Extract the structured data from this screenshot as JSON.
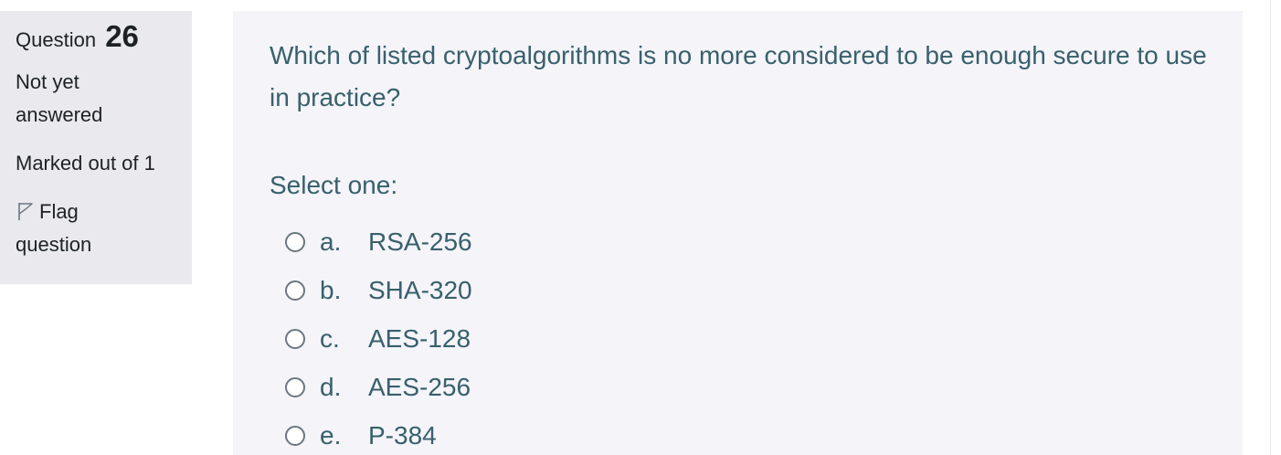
{
  "info": {
    "question_label": "Question",
    "question_number": "26",
    "state": "Not yet answered",
    "grade": "Marked out of 1",
    "flag_label": "Flag question"
  },
  "question": {
    "text": "Which of listed cryptoalgorithms is no more considered to be enough secure to use in practice?",
    "prompt": "Select one:",
    "answers": [
      {
        "letter": "a.",
        "text": "RSA-256"
      },
      {
        "letter": "b.",
        "text": "SHA-320"
      },
      {
        "letter": "c.",
        "text": "AES-128"
      },
      {
        "letter": "d.",
        "text": "AES-256"
      },
      {
        "letter": "e.",
        "text": "P-384"
      }
    ]
  },
  "icons": {
    "flag": "flag-outline-icon",
    "radio": "radio-unchecked-icon"
  },
  "colors": {
    "info_bg": "#e9e9ee",
    "content_bg": "#f4f4f9",
    "text": "#38606c",
    "info_text": "#1d2125"
  }
}
